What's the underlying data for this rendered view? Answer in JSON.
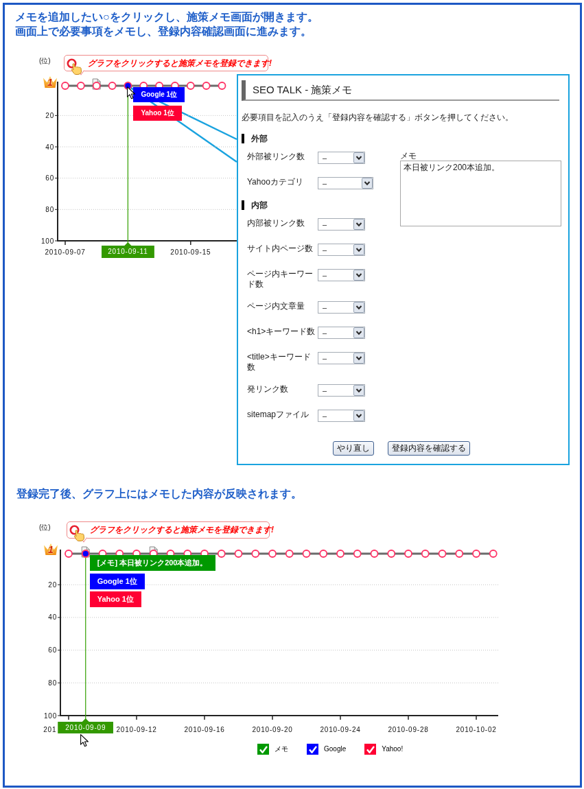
{
  "intro": [
    "メモを追加したい○をクリックし、施策メモ画面が開きます。",
    "画面上で必要事項をメモし、登録内容確認画面に進みます。"
  ],
  "chart_1": {
    "hint": "グラフをクリックすると施策メモを登録できます!",
    "top_rank_badge": "1",
    "chart_data": {
      "type": "line",
      "ylabel": "(位)",
      "categories": [
        "2010-09-07",
        null,
        null,
        null,
        "2010-09-11",
        null,
        null,
        null,
        "2010-09-15",
        null,
        null
      ],
      "series": [
        {
          "color": "#ff3366",
          "marker": "circle",
          "values": [
            1,
            1,
            1,
            1,
            1,
            1,
            1,
            1,
            1,
            1,
            1
          ]
        }
      ],
      "ylim": [
        100,
        1
      ],
      "yticks": [
        20,
        40,
        60,
        80,
        100
      ],
      "grid": true
    },
    "point_marks": [
      {
        "memo": false,
        "selected": false
      },
      {
        "memo": false,
        "selected": false
      },
      {
        "memo": true,
        "selected": false
      },
      {
        "memo": false,
        "selected": false
      },
      {
        "memo": false,
        "selected": true
      },
      {
        "memo": false,
        "selected": false
      },
      {
        "memo": false,
        "selected": false
      },
      {
        "memo": false,
        "selected": false
      },
      {
        "memo": false,
        "selected": false
      },
      {
        "memo": false,
        "selected": false
      },
      {
        "memo": false,
        "selected": false
      }
    ],
    "point_labels": [
      {
        "text": "Google 1位",
        "color": "#0000ff"
      },
      {
        "text": "Yahoo 1位",
        "color": "#ff0033"
      }
    ]
  },
  "memo_dialog": {
    "title": "SEO TALK - 施策メモ",
    "instruction": "必要項目を記入のうえ「登録内容を確認する」ボタンを押してください。",
    "sections": [
      {
        "heading": "外部",
        "fields": [
          {
            "label": "外部被リンク数",
            "value": "–"
          },
          {
            "label": "Yahooカテゴリ",
            "value": "–"
          }
        ]
      },
      {
        "heading": "内部",
        "fields": [
          {
            "label": "内部被リンク数",
            "value": "–"
          },
          {
            "label": "サイト内ページ数",
            "value": "–"
          },
          {
            "label": "ページ内キーワード数",
            "value": "–"
          },
          {
            "label": "ページ内文章量",
            "value": "–"
          },
          {
            "label": "<h1>キーワード数",
            "value": "–"
          },
          {
            "label": "<title>キーワード数",
            "value": "–"
          },
          {
            "label": "発リンク数",
            "value": "–"
          },
          {
            "label": "sitemapファイル",
            "value": "–"
          }
        ]
      }
    ],
    "memo": {
      "label": "メモ",
      "value": "本日被リンク200本追加。"
    },
    "buttons": [
      "やり直し",
      "登録内容を確認する"
    ]
  },
  "result_note": "登録完了後、グラフ上にはメモした内容が反映されます。",
  "chart_2": {
    "hint": "グラフをクリックすると施策メモを登録できます!",
    "top_rank_badge": "1",
    "chart_data": {
      "type": "line",
      "ylabel": "(位)",
      "categories": [
        null,
        "2010-09-09",
        null,
        null,
        "2010-09-12",
        null,
        null,
        null,
        "2010-09-16",
        null,
        null,
        null,
        "2010-09-20",
        null,
        null,
        null,
        "2010-09-24",
        null,
        null,
        null,
        "2010-09-28",
        null,
        null,
        null,
        "2010-10-02",
        null
      ],
      "series": [
        {
          "color": "#ff3366",
          "marker": "circle",
          "values": [
            1,
            1,
            1,
            1,
            1,
            1,
            1,
            1,
            1,
            1,
            1,
            1,
            1,
            1,
            1,
            1,
            1,
            1,
            1,
            1,
            1,
            1,
            1,
            1,
            1,
            1
          ]
        }
      ],
      "ylim": [
        100,
        1
      ],
      "yticks": [
        20,
        40,
        60,
        80,
        100
      ],
      "grid": true
    },
    "cut_axis_label": "201",
    "point_marks": [
      {
        "memo": false,
        "selected": false
      },
      {
        "memo": true,
        "selected": true
      },
      {
        "memo": false,
        "selected": false
      },
      {
        "memo": false,
        "selected": false
      },
      {
        "memo": false,
        "selected": false
      },
      {
        "memo": true,
        "selected": false
      },
      {
        "memo": false,
        "selected": false
      },
      {
        "memo": false,
        "selected": false
      },
      {
        "memo": false,
        "selected": false
      },
      {
        "memo": false,
        "selected": false
      },
      {
        "memo": false,
        "selected": false
      },
      {
        "memo": false,
        "selected": false
      },
      {
        "memo": false,
        "selected": false
      },
      {
        "memo": false,
        "selected": false
      },
      {
        "memo": false,
        "selected": false
      },
      {
        "memo": false,
        "selected": false
      },
      {
        "memo": false,
        "selected": false
      },
      {
        "memo": false,
        "selected": false
      },
      {
        "memo": false,
        "selected": false
      },
      {
        "memo": false,
        "selected": false
      },
      {
        "memo": false,
        "selected": false
      },
      {
        "memo": false,
        "selected": false
      },
      {
        "memo": false,
        "selected": false
      },
      {
        "memo": false,
        "selected": false
      },
      {
        "memo": false,
        "selected": false
      },
      {
        "memo": false,
        "selected": false
      }
    ],
    "point_labels": [
      {
        "text": "[メモ] 本日被リンク200本追加。",
        "color": "#009900"
      },
      {
        "text": "Google 1位",
        "color": "#0000ff"
      },
      {
        "text": "Yahoo 1位",
        "color": "#ff0033"
      }
    ],
    "legend": [
      {
        "label": "メモ",
        "color": "#009900",
        "checked": true
      },
      {
        "label": "Google",
        "color": "#0000ff",
        "checked": true
      },
      {
        "label": "Yahoo!",
        "color": "#ff0033",
        "checked": true
      }
    ]
  }
}
